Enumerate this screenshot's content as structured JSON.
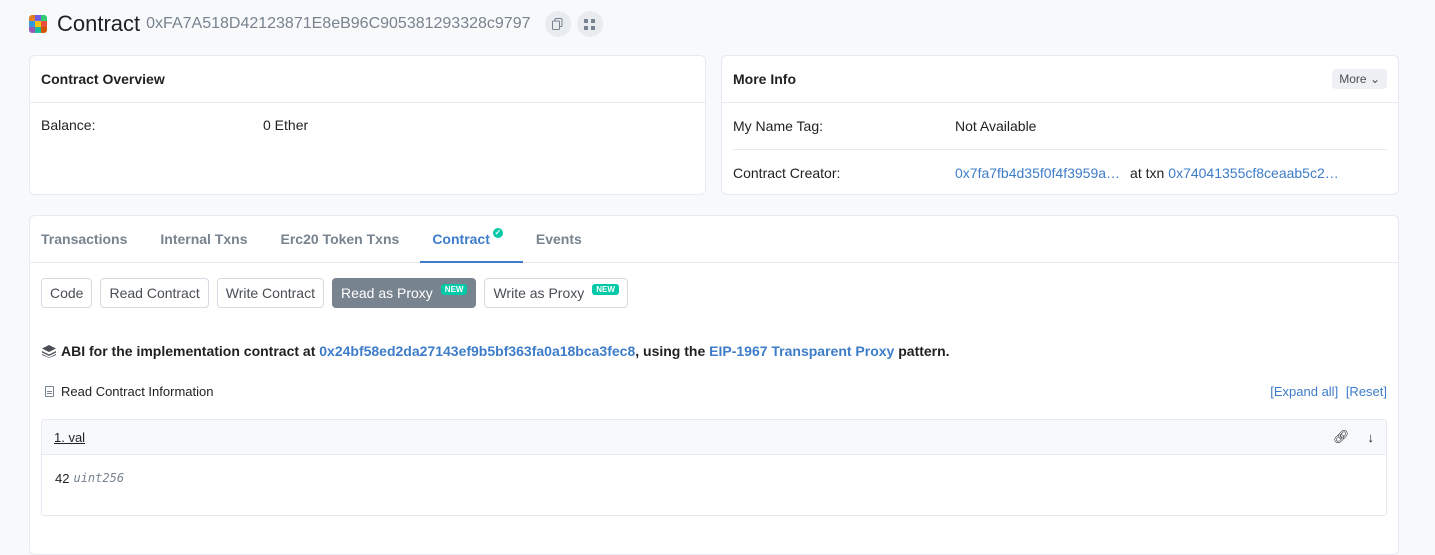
{
  "header": {
    "title": "Contract",
    "address": "0xFA7A518D42123871E8eB96C905381293328c9797"
  },
  "overview": {
    "title": "Contract Overview",
    "balance_label": "Balance:",
    "balance_value": "0 Ether"
  },
  "more_info": {
    "title": "More Info",
    "more_button": "More",
    "name_tag_label": "My Name Tag:",
    "name_tag_value": "Not Available",
    "creator_label": "Contract Creator:",
    "creator_address": "0x7fa7fb4d35f0f4f3959a…",
    "at_txn_label": "at txn",
    "creator_txn": "0x74041355cf8ceaab5c2…"
  },
  "tabs": [
    {
      "label": "Transactions"
    },
    {
      "label": "Internal Txns"
    },
    {
      "label": "Erc20 Token Txns"
    },
    {
      "label": "Contract"
    },
    {
      "label": "Events"
    }
  ],
  "subtabs": [
    {
      "label": "Code"
    },
    {
      "label": "Read Contract"
    },
    {
      "label": "Write Contract"
    },
    {
      "label": "Read as Proxy",
      "badge": "NEW"
    },
    {
      "label": "Write as Proxy",
      "badge": "NEW"
    }
  ],
  "abi": {
    "prefix": "ABI for the implementation contract at",
    "impl_address": "0x24bf58ed2da27143ef9b5bf363fa0a18bca3fec8",
    "middle": ", using the",
    "pattern_link": "EIP-1967 Transparent Proxy",
    "suffix": "pattern."
  },
  "read_info": {
    "title": "Read Contract Information",
    "expand_all": "[Expand all]",
    "reset": "[Reset]"
  },
  "method": {
    "name": "1. val",
    "value": "42",
    "type": "uint256"
  },
  "colors": {
    "accent": "#3d7cc9",
    "badge": "#00c9a7",
    "active_subtab": "#77838f"
  }
}
